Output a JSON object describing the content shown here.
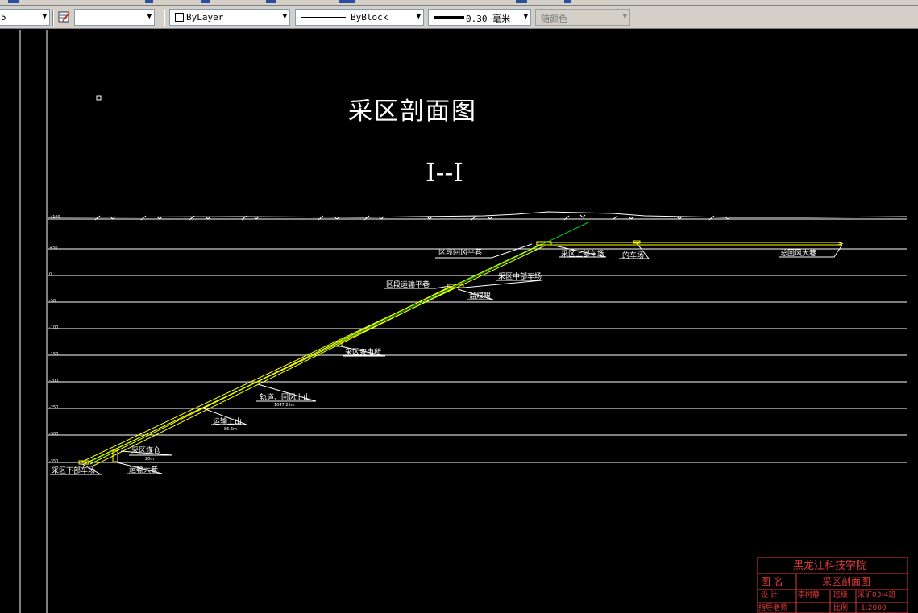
{
  "toolbar": {
    "color_control": "5",
    "layer_control": "",
    "color": "ByLayer",
    "linetype": "ByBlock",
    "lineweight": "0.30 毫米",
    "plot_style": "随颜色",
    "accent": "#2a4f9e"
  },
  "drawing": {
    "title": "采区剖面图",
    "section": "I--I",
    "elevations": [
      "+100",
      "+50",
      "0",
      "-50",
      "-100",
      "-150",
      "-200",
      "-250",
      "-300",
      "-350"
    ],
    "labels": {
      "return_air_level": "区段回风平巷",
      "upper_yard": "采区上部车场",
      "car_yard": "的车场",
      "main_return": "总回风大巷",
      "transport_level": "区段运输平巷",
      "middle_yard": "采区中部车场",
      "coal_chute": "溜煤眼",
      "substation": "采区变电所",
      "track_incline": "轨道、回风上山",
      "track_len": "1047.25m",
      "transport_incline": "运输上山",
      "transport_len": "86.6m",
      "coal_bunker": "采区煤仓",
      "bunker_len": "20m",
      "lower_yard": "采区下部车场",
      "main_haulage": "运输大巷"
    }
  },
  "title_block": {
    "school": "黑龙江科技学院",
    "name_label": "图 名",
    "name_value": "采区剖面图",
    "design_label": "设 计",
    "designer": "李树静",
    "class_label": "班级",
    "class_value": "采矿03-4班",
    "advisor_label": "指导老师",
    "scale_label": "比例",
    "scale_value": "1:2000"
  },
  "colors": {
    "background": "#000000",
    "lines": "#ffffff",
    "seam": "#ffff00",
    "air": "#00d000",
    "title_block": "#e23838"
  }
}
